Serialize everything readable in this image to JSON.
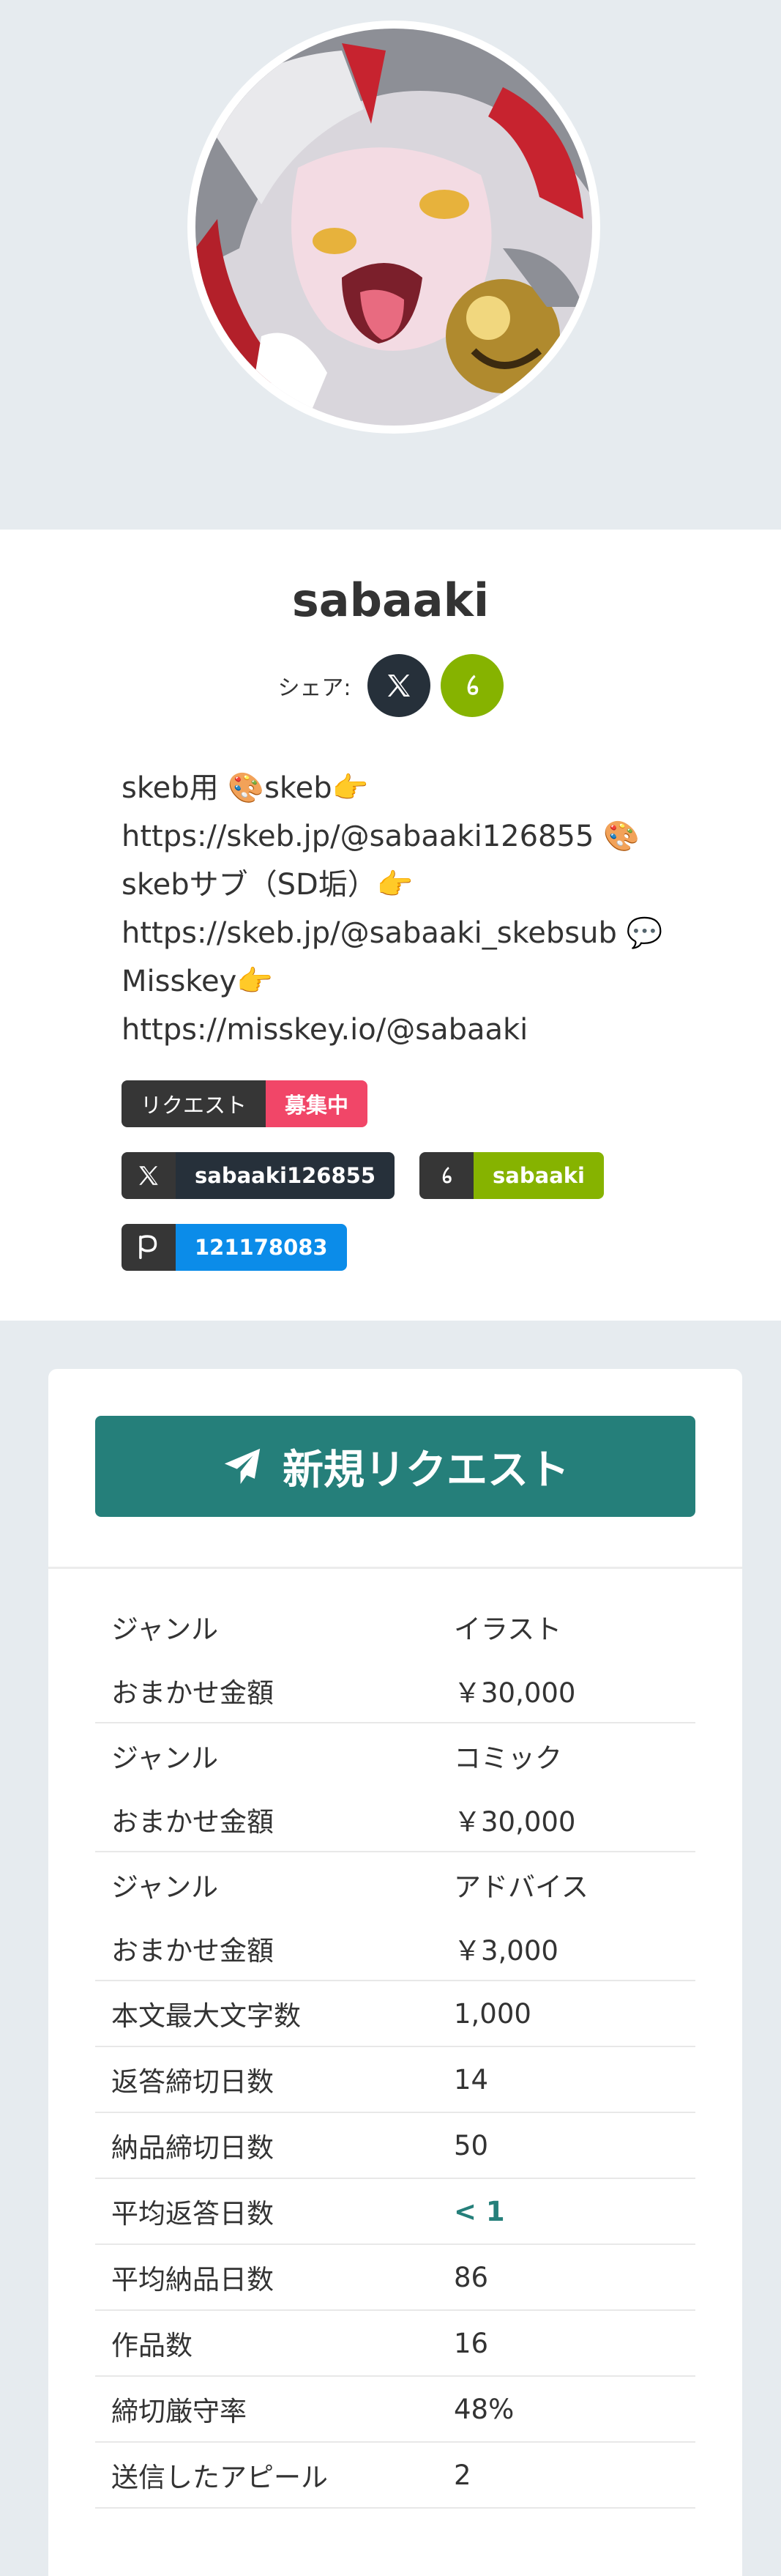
{
  "colors": {
    "page_bg": "#e6ebef",
    "accent_teal": "#257f7a",
    "misskey_green": "#86b300",
    "badge_pink": "#f14668",
    "pixiv_blue": "#0b8ce9",
    "dark": "#26303a"
  },
  "profile": {
    "username": "sabaaki",
    "share_label": "シェア:",
    "share_buttons": [
      {
        "icon": "x-logo-icon"
      },
      {
        "icon": "misskey-logo-icon"
      }
    ],
    "bio": [
      "skeb用 🎨skeb👉",
      "https://skeb.jp/@sabaaki126855 🎨",
      "skebサブ（SD垢）👉",
      "https://skeb.jp/@sabaaki_skebsub 💬",
      "Misskey👉",
      "https://misskey.io/@sabaaki"
    ]
  },
  "tags": {
    "request": {
      "label": "リクエスト",
      "status": "募集中"
    },
    "x_account": {
      "icon": "x-logo-icon",
      "value": "sabaaki126855"
    },
    "misskey_account": {
      "icon": "misskey-logo-icon",
      "value": "sabaaki"
    },
    "pixiv_account": {
      "icon": "pixiv-logo-icon",
      "value": "121178083"
    }
  },
  "request_card": {
    "button_label": "新規リクエスト",
    "button_icon": "paper-plane-icon",
    "prices": [
      {
        "genre_label": "ジャンル",
        "genre": "イラスト",
        "price_label": "おまかせ金額",
        "price": "￥30,000"
      },
      {
        "genre_label": "ジャンル",
        "genre": "コミック",
        "price_label": "おまかせ金額",
        "price": "￥30,000"
      },
      {
        "genre_label": "ジャンル",
        "genre": "アドバイス",
        "price_label": "おまかせ金額",
        "price": "￥3,000"
      }
    ],
    "stats": [
      {
        "label": "本文最大文字数",
        "value": "1,000"
      },
      {
        "label": "返答締切日数",
        "value": "14"
      },
      {
        "label": "納品締切日数",
        "value": "50"
      },
      {
        "label": "平均返答日数",
        "value": "< 1"
      },
      {
        "label": "平均納品日数",
        "value": "86"
      },
      {
        "label": "作品数",
        "value": "16"
      },
      {
        "label": "締切厳守率",
        "value": "48%"
      },
      {
        "label": "送信したアピール",
        "value": "2"
      }
    ]
  }
}
